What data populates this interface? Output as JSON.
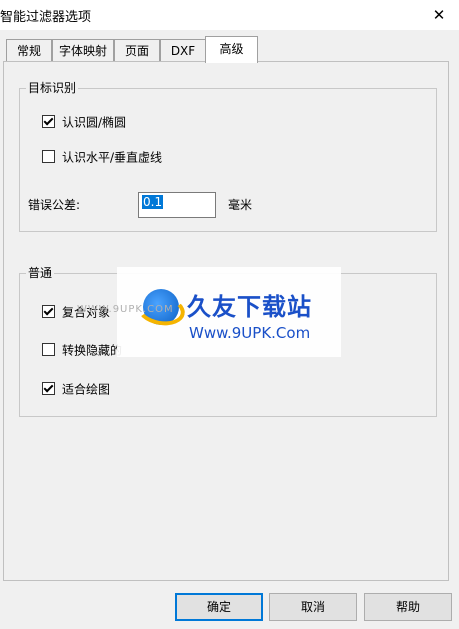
{
  "window": {
    "title": "智能过滤器选项",
    "close_glyph": "✕"
  },
  "tabs": [
    {
      "label": "常规"
    },
    {
      "label": "字体映射"
    },
    {
      "label": "页面"
    },
    {
      "label": "DXF"
    },
    {
      "label": "高级",
      "active": true
    }
  ],
  "target_group": {
    "title": "目标识别",
    "recognize_circle": {
      "label": "认识圆/椭圆",
      "checked": true
    },
    "recognize_lines": {
      "label": "认识水平/垂直虚线",
      "checked": false
    },
    "tolerance": {
      "label": "错误公差:",
      "value": "0.1",
      "unit": "毫米"
    }
  },
  "general_group": {
    "title": "普通",
    "combine_objects": {
      "label": "复合对象",
      "checked": true
    },
    "convert_hidden": {
      "label": "转换隐藏的",
      "checked": false
    },
    "fit_drawing": {
      "label": "适合绘图",
      "checked": true
    }
  },
  "watermark": {
    "brand": "久友下载站",
    "url": "Www.9UPK.Com",
    "ghost_text": "WWW.9UPK.COM"
  },
  "buttons": {
    "ok": "确定",
    "cancel": "取消",
    "help": "帮助"
  },
  "icons": {
    "close": "close-icon",
    "check": "checkmark-icon",
    "logo": "logo-icon"
  }
}
